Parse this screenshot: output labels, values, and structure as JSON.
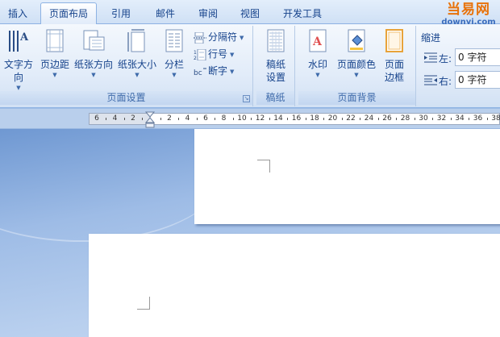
{
  "tabs": [
    {
      "label": "插入",
      "active": false
    },
    {
      "label": "页面布局",
      "active": true
    },
    {
      "label": "引用",
      "active": false
    },
    {
      "label": "邮件",
      "active": false
    },
    {
      "label": "审阅",
      "active": false
    },
    {
      "label": "视图",
      "active": false
    },
    {
      "label": "开发工具",
      "active": false
    }
  ],
  "logo": {
    "title": "当易网",
    "url": "downyi.com"
  },
  "ribbon": {
    "page_setup": {
      "label": "页面设置",
      "text_direction": "文字方向",
      "margins": "页边距",
      "orientation": "纸张方向",
      "size": "纸张大小",
      "columns": "分栏",
      "breaks": "分隔符",
      "line_numbers": "行号",
      "hyphenation": "断字"
    },
    "manuscript": {
      "label": "稿纸",
      "settings_line1": "稿纸",
      "settings_line2": "设置"
    },
    "background": {
      "label": "页面背景",
      "watermark": "水印",
      "page_color": "页面颜色",
      "borders_line1": "页面",
      "borders_line2": "边框"
    },
    "indent": {
      "title": "缩进",
      "left_label": "左:",
      "left_value": "0 字符",
      "right_label": "右:",
      "right_value": "0 字符"
    }
  },
  "ruler": {
    "labels": [
      "6",
      "4",
      "2",
      "",
      "2",
      "4",
      "6",
      "8",
      "10",
      "12",
      "14",
      "16",
      "18",
      "20",
      "22",
      "24",
      "26",
      "28",
      "30",
      "32",
      "34",
      "36",
      "38"
    ]
  },
  "colors": {
    "accent": "#15428b",
    "logo_orange": "#e8730b",
    "doc_background": "#9fbde6"
  }
}
